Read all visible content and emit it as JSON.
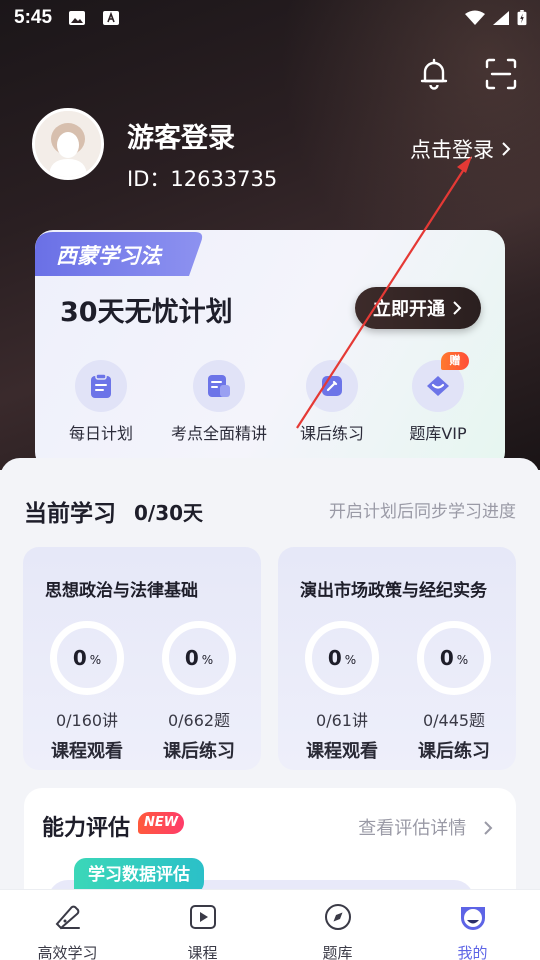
{
  "status_bar": {
    "time": "5:45"
  },
  "profile": {
    "username": "游客登录",
    "user_id": "ID：12633735",
    "login_link": "点击登录"
  },
  "plan_card": {
    "tab_label": "西蒙学习法",
    "title": "30天无忧计划",
    "open_button": "立即开通",
    "gift_badge": "赠",
    "features": [
      {
        "label": "每日计划",
        "icon": "daily-plan-icon"
      },
      {
        "label": "考点全面精讲",
        "icon": "lecture-icon"
      },
      {
        "label": "课后练习",
        "icon": "practice-icon"
      },
      {
        "label": "题库VIP",
        "icon": "vip-icon"
      }
    ]
  },
  "current_study": {
    "title": "当前学习",
    "count": "0/30天",
    "hint": "开启计划后同步学习进度",
    "courses": [
      {
        "name": "思想政治与法律基础",
        "lessons_progress": {
          "num": "0",
          "pct": "%"
        },
        "practice_progress": {
          "num": "0",
          "pct": "%"
        },
        "lessons_count": "0/160讲",
        "practice_count": "0/662题",
        "lessons_label": "课程观看",
        "practice_label": "课后练习"
      },
      {
        "name": "演出市场政策与经纪实务",
        "lessons_progress": {
          "num": "0",
          "pct": "%"
        },
        "practice_progress": {
          "num": "0",
          "pct": "%"
        },
        "lessons_count": "0/61讲",
        "practice_count": "0/445题",
        "lessons_label": "课程观看",
        "practice_label": "课后练习"
      }
    ]
  },
  "ability": {
    "title": "能力评估",
    "new_badge": "NEW",
    "link": "查看评估详情",
    "eval_tag": "学习数据评估"
  },
  "tabbar": {
    "items": [
      {
        "label": "高效学习",
        "icon": "study-icon"
      },
      {
        "label": "课程",
        "icon": "course-play-icon"
      },
      {
        "label": "题库",
        "icon": "compass-icon"
      },
      {
        "label": "我的",
        "icon": "profile-icon"
      }
    ],
    "active_index": 3
  },
  "colors": {
    "accent": "#5d64e6",
    "plan_tab": "#6c74e8",
    "dark_button": "#3d2b2a",
    "annotation_arrow": "#e53935"
  }
}
